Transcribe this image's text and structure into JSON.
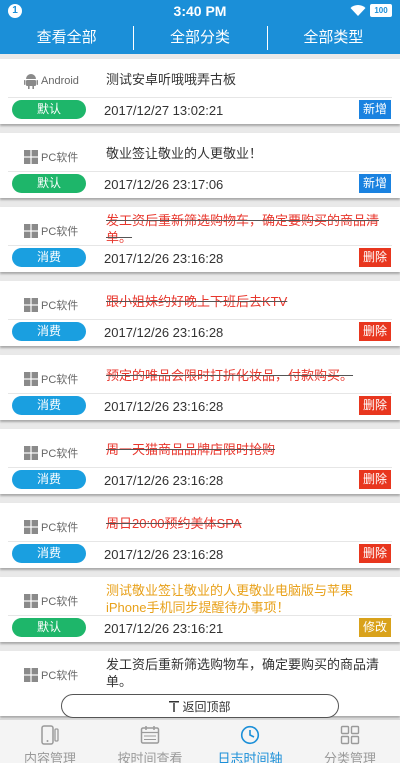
{
  "status_bar": {
    "notification": "1",
    "time": "3:40 PM",
    "battery": "100"
  },
  "filters": [
    "查看全部",
    "全部分类",
    "全部类型"
  ],
  "colors": {
    "primary": "#1b8fd8",
    "tag_default": "#1eb66a",
    "tag_consume": "#1a9fe0",
    "action_add": "#1a82e0",
    "action_delete": "#e8361e",
    "action_edit": "#d9a21b",
    "text_struck": "#e8362c",
    "text_highlight": "#e8a11a"
  },
  "records": [
    {
      "platform": "Android",
      "platform_icon": "android-icon",
      "title": "测试安卓听哦哦弄古板",
      "tag": "默认",
      "date": "2017/12/27 13:02:21",
      "action": "新增"
    },
    {
      "platform": "PC软件",
      "platform_icon": "windows-icon",
      "title": "敬业签让敬业的人更敬业！",
      "tag": "默认",
      "date": "2017/12/26 23:17:06",
      "action": "新增"
    },
    {
      "platform": "PC软件",
      "platform_icon": "windows-icon",
      "title": "发工资后重新筛选购物车，确定要购买的商品清单。",
      "tag": "消费",
      "date": "2017/12/26 23:16:28",
      "action": "删除"
    },
    {
      "platform": "PC软件",
      "platform_icon": "windows-icon",
      "title": "跟小姐妹约好晚上下班后去KTV",
      "tag": "消费",
      "date": "2017/12/26 23:16:28",
      "action": "删除"
    },
    {
      "platform": "PC软件",
      "platform_icon": "windows-icon",
      "title": "预定的唯品会限时打折化妆品，付款购买。",
      "tag": "消费",
      "date": "2017/12/26 23:16:28",
      "action": "删除"
    },
    {
      "platform": "PC软件",
      "platform_icon": "windows-icon",
      "title": "周一天猫商品品牌店限时抢购",
      "tag": "消费",
      "date": "2017/12/26 23:16:28",
      "action": "删除"
    },
    {
      "platform": "PC软件",
      "platform_icon": "windows-icon",
      "title": "周日20:00预约美体SPA",
      "tag": "消费",
      "date": "2017/12/26 23:16:28",
      "action": "删除"
    },
    {
      "platform": "PC软件",
      "platform_icon": "windows-icon",
      "title": "测试敬业签让敬业的人更敬业电脑版与苹果iPhone手机同步提醒待办事项！",
      "tag": "默认",
      "date": "2017/12/26 23:16:21",
      "action": "修改"
    },
    {
      "platform": "PC软件",
      "platform_icon": "windows-icon",
      "title": "发工资后重新筛选购物车，确定要购买的商品清单。",
      "tag": "",
      "date": "",
      "action": ""
    }
  ],
  "back_to_top": "返回顶部",
  "tabs": [
    {
      "label": "内容管理",
      "icon": "phone-icon"
    },
    {
      "label": "按时间查看",
      "icon": "calendar-icon"
    },
    {
      "label": "日志时间轴",
      "icon": "clock-icon"
    },
    {
      "label": "分类管理",
      "icon": "grid-icon"
    }
  ]
}
